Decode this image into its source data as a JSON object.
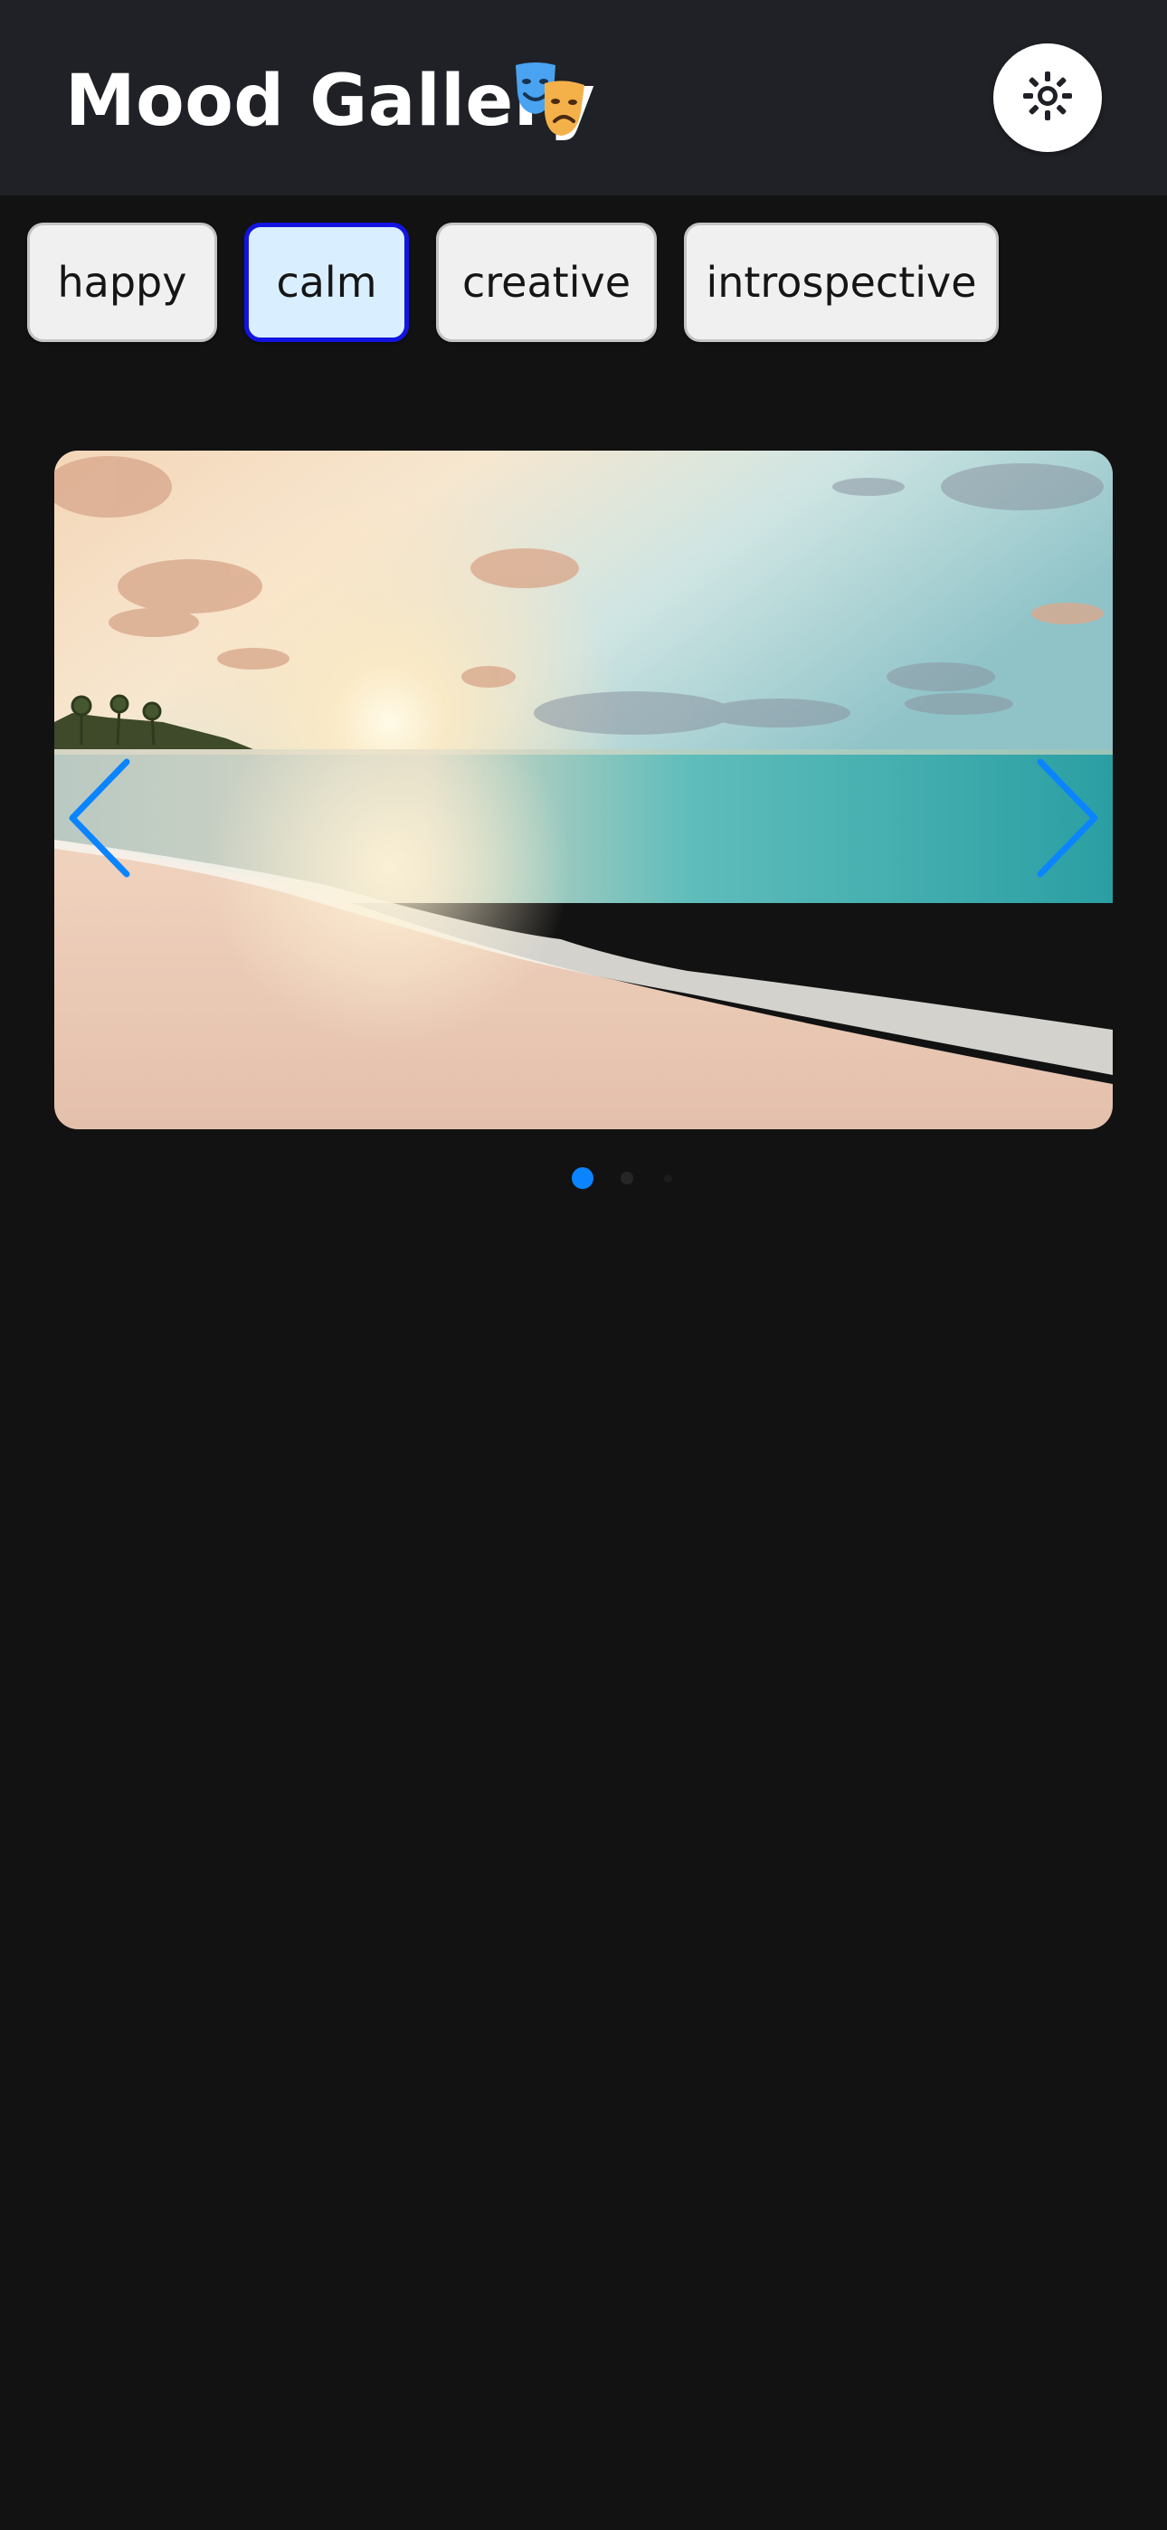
{
  "header": {
    "title": "Mood Gallery",
    "title_icon": "performing-arts-masks-icon",
    "theme_toggle_icon": "sun-icon"
  },
  "moods": [
    {
      "label": "happy",
      "active": false
    },
    {
      "label": "calm",
      "active": true
    },
    {
      "label": "creative",
      "active": false
    },
    {
      "label": "introspective",
      "active": false
    }
  ],
  "carousel": {
    "image_subject": "beach-sunset-photo",
    "prev_icon": "chevron-left-icon",
    "next_icon": "chevron-right-icon",
    "slide_count": 3,
    "current_slide": 1
  },
  "colors": {
    "background": "#121212",
    "header": "#1f2126",
    "accent": "#0b84ff",
    "active_chip_border": "#1414e0",
    "active_chip_fill": "#d9efff",
    "chip_fill": "#f0f0f0"
  }
}
